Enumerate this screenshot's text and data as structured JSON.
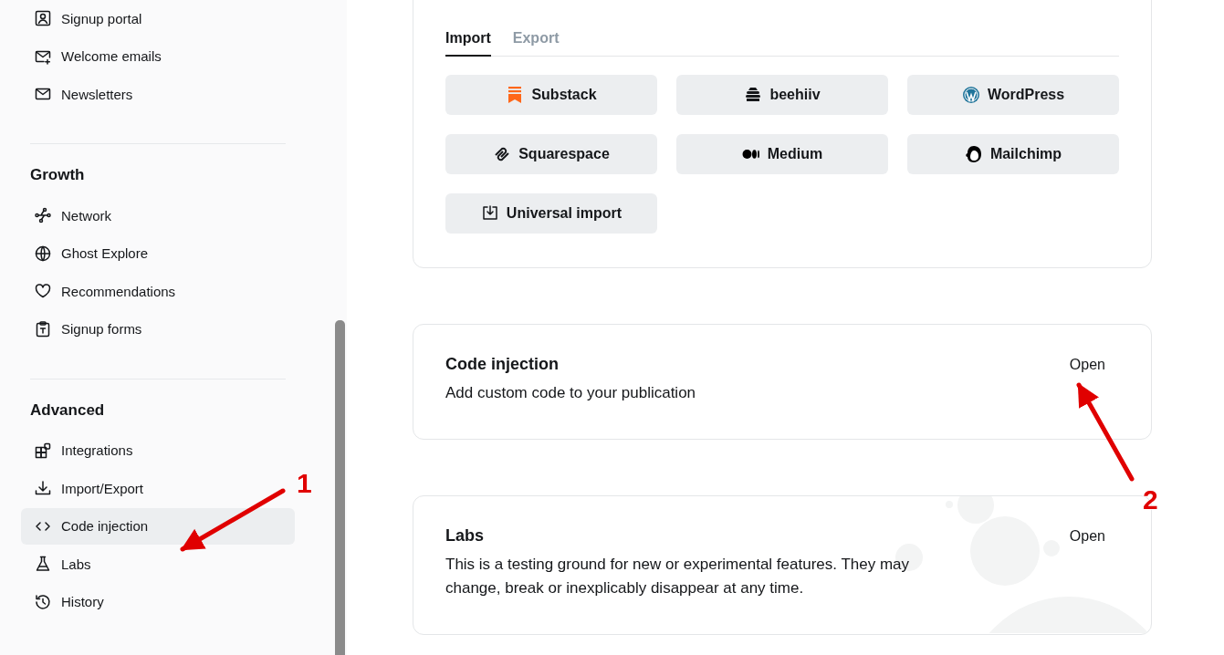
{
  "sidebar": {
    "sections": [
      {
        "items": [
          {
            "label": "Signup portal",
            "selected": false
          },
          {
            "label": "Welcome emails",
            "selected": false
          },
          {
            "label": "Newsletters",
            "selected": false
          }
        ]
      },
      {
        "heading": "Growth",
        "items": [
          {
            "label": "Network",
            "selected": false
          },
          {
            "label": "Ghost Explore",
            "selected": false
          },
          {
            "label": "Recommendations",
            "selected": false
          },
          {
            "label": "Signup forms",
            "selected": false
          }
        ]
      },
      {
        "heading": "Advanced",
        "items": [
          {
            "label": "Integrations",
            "selected": false
          },
          {
            "label": "Import/Export",
            "selected": false
          },
          {
            "label": "Code injection",
            "selected": true
          },
          {
            "label": "Labs",
            "selected": false
          },
          {
            "label": "History",
            "selected": false
          }
        ]
      }
    ]
  },
  "import_export": {
    "tabs": [
      {
        "label": "Import",
        "selected": true
      },
      {
        "label": "Export",
        "selected": false
      }
    ],
    "sources": [
      {
        "label": "Substack"
      },
      {
        "label": "beehiiv"
      },
      {
        "label": "WordPress"
      },
      {
        "label": "Squarespace"
      },
      {
        "label": "Medium"
      },
      {
        "label": "Mailchimp"
      },
      {
        "label": "Universal import"
      }
    ]
  },
  "cards": [
    {
      "title": "Code injection",
      "description": "Add custom code to your publication",
      "action": "Open",
      "kind": "plain"
    },
    {
      "title": "Labs",
      "description": "This is a testing ground for new or experimental features. They may change, break or inexplicably disappear at any time.",
      "action": "Open",
      "kind": "bubbles"
    }
  ],
  "annotations": [
    {
      "label": "1"
    },
    {
      "label": "2"
    }
  ]
}
